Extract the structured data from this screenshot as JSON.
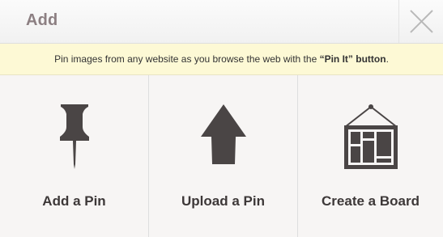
{
  "header": {
    "title": "Add",
    "close_icon": "close-icon"
  },
  "banner": {
    "text_before": "Pin images from any website as you browse the web with the ",
    "button_name": "“Pin It” button",
    "text_after": "."
  },
  "options": [
    {
      "label": "Add a Pin",
      "icon": "pushpin-icon"
    },
    {
      "label": "Upload a Pin",
      "icon": "upload-arrow-icon"
    },
    {
      "label": "Create a Board",
      "icon": "board-icon"
    }
  ],
  "colors": {
    "icon": "#4a4545",
    "title": "#8c7f82",
    "banner_bg": "#fdf9d5",
    "background": "#f7f5f4"
  }
}
